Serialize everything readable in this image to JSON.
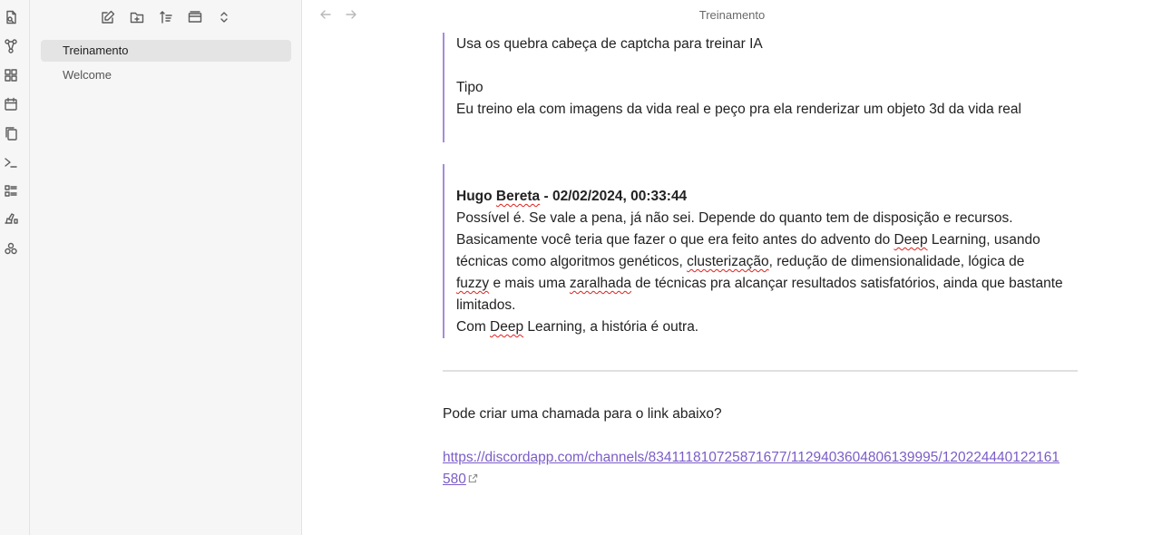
{
  "ribbon": {
    "icons": [
      "open-file-icon",
      "graph-view-icon",
      "canvas-icon",
      "calendar-icon",
      "copy-icon",
      "terminal-icon",
      "outline-icon",
      "template-icon",
      "plugins-icon"
    ]
  },
  "sidebar": {
    "toolbar_icons": [
      "new-note-icon",
      "new-folder-icon",
      "sort-icon",
      "collapse-icon",
      "expand-icon"
    ],
    "files": [
      {
        "label": "Treinamento",
        "active": true
      },
      {
        "label": "Welcome",
        "active": false
      }
    ]
  },
  "header": {
    "title": "Treinamento"
  },
  "note": {
    "quote1": {
      "line1": "Usa os quebra cabeça de captcha para treinar IA",
      "line2": "Tipo",
      "line3": "Eu treino ela com imagens da vida real e peço pra ela renderizar um objeto 3d da vida real"
    },
    "quote2": {
      "author_first": "Hugo",
      "author_last": "Bereta",
      "author_rest": " - 02/02/2024, 00:33:44",
      "l1": "Possível é. Se vale a pena, já não sei. Depende do quanto tem de disposição e recursos.",
      "l2a": "Basicamente você teria que fazer o que era feito antes do advento do ",
      "l2b": "Deep",
      "l2c": " Learning, usando",
      "l3a": "técnicas como algoritmos genéticos, ",
      "l3b": "clusterização",
      "l3c": ", redução de dimensionalidade, lógica de",
      "l4a": "fuzzy",
      "l4b": " e mais uma ",
      "l4c": "zaralhada",
      "l4d": " de técnicas pra alcançar resultados satisfatórios, ainda que bastante",
      "l5": "limitados.",
      "l6a": "Com ",
      "l6b": "Deep",
      "l6c": " Learning, a história é outra."
    },
    "question": "Pode criar uma chamada para o link abaixo?",
    "link_line1": "https://discordapp.com/channels/834111810725871677/1129403604806139995/120224440122161",
    "link_line2": "580"
  },
  "colors": {
    "accent": "#7b5cc7",
    "quote_border": "#a88bdb",
    "sidebar_bg": "#f6f6f6",
    "active_item_bg": "#e4e4e4"
  }
}
